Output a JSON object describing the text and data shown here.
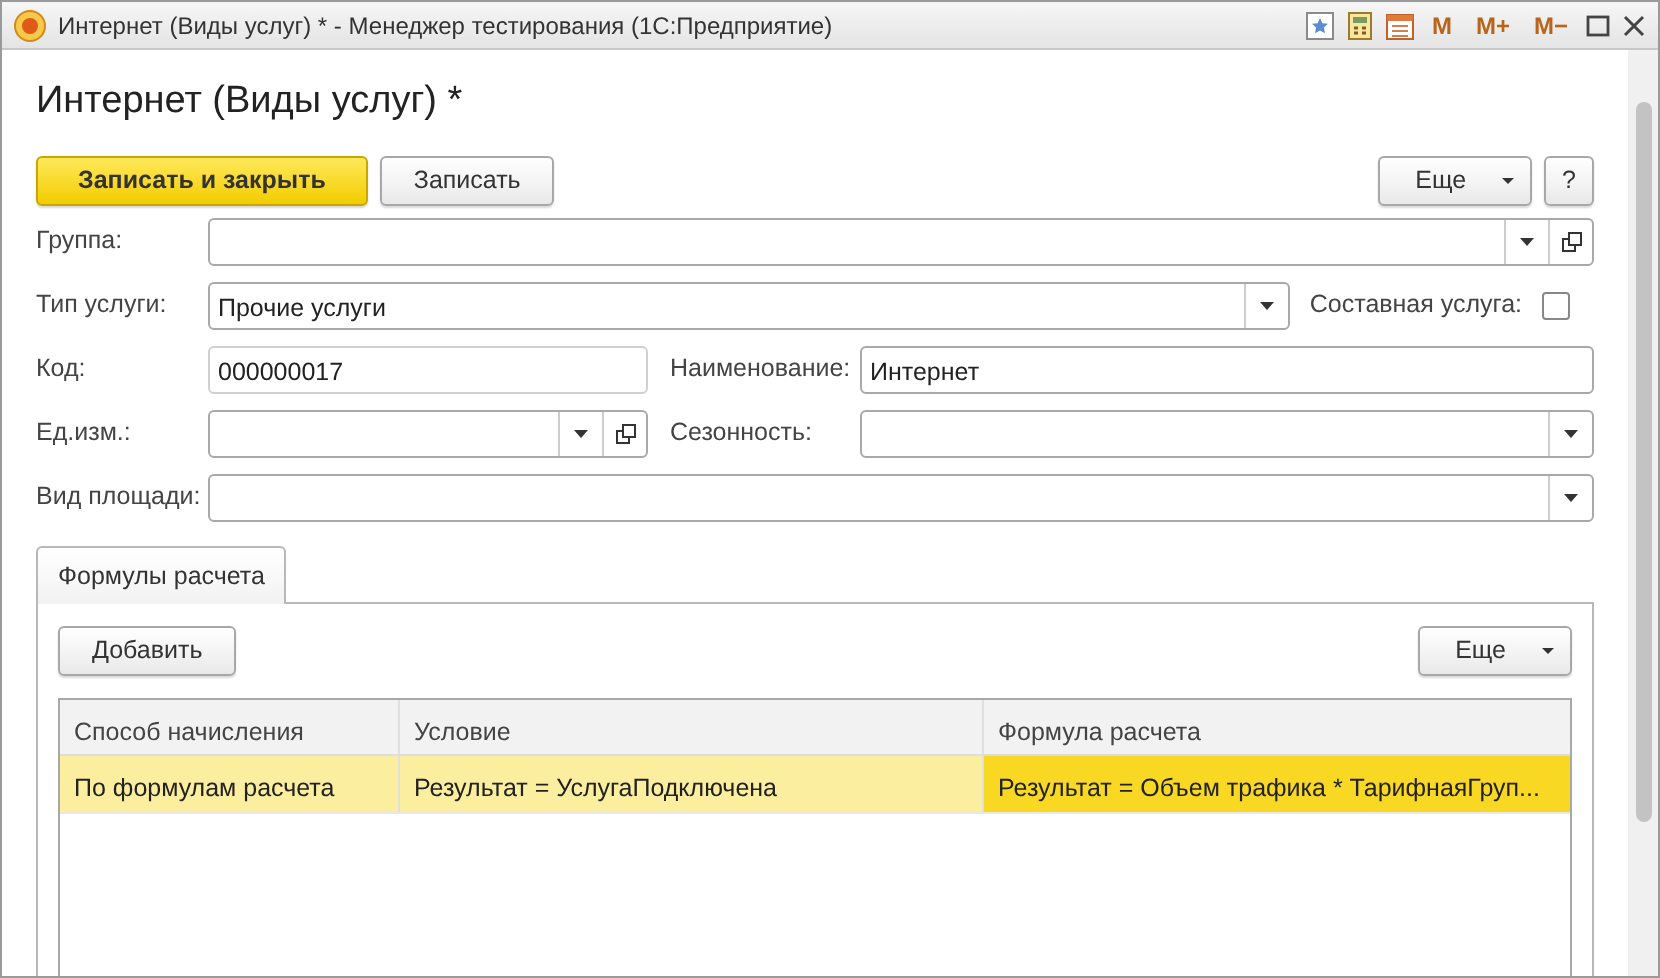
{
  "window": {
    "title": "Интернет (Виды услуг) * - Менеджер тестирования (1С:Предприятие)",
    "memory_buttons": [
      "M",
      "M+",
      "M−"
    ]
  },
  "form": {
    "title": "Интернет (Виды услуг) *",
    "toolbar": [
      {
        "label": "Записать и закрыть",
        "kind": "primary"
      },
      {
        "label": "Записать",
        "kind": "plain"
      }
    ],
    "toolbar_right": [
      {
        "label": "Еще",
        "kind": "menu"
      },
      {
        "label": "?",
        "kind": "plain"
      }
    ],
    "rows": [
      [
        {
          "kind": "select",
          "label": "Группа:",
          "open_button": true
        }
      ],
      [
        {
          "kind": "select",
          "label": "Тип услуги:",
          "value": "Прочие услуги",
          "open_button": false
        },
        {
          "kind": "checkbox",
          "label": "Составная услуга:",
          "checked": false
        }
      ],
      [
        {
          "kind": "text",
          "label": "Код:",
          "value": "000000017",
          "disabled": true
        },
        {
          "kind": "text",
          "label": "Наименование:",
          "value": "Интернет",
          "disabled": false
        }
      ],
      [
        {
          "kind": "select",
          "label": "Ед.изм.:",
          "open_button": true
        },
        {
          "kind": "select",
          "label": "Сезонность:",
          "open_button": false
        }
      ],
      [
        {
          "kind": "select",
          "label": "Вид площади:",
          "open_button": false
        }
      ]
    ]
  },
  "tabs": [
    {
      "label": "Формулы расчета",
      "selected": true
    }
  ],
  "tab_toolbar": {
    "left": [
      {
        "label": "Добавить",
        "kind": "plain"
      }
    ],
    "right": [
      {
        "label": "Еще",
        "kind": "menu"
      }
    ]
  },
  "table": {
    "columns": [
      "Способ начисления",
      "Условие",
      "Формула расчета"
    ],
    "rows": [
      {
        "selected": true,
        "cells": [
          {
            "text": "По формулам расчета",
            "current": false
          },
          {
            "text": "Результат = УслугаПодключена",
            "current": false
          },
          {
            "text": "Результат = Объем трафика * ТарифнаяГруп...",
            "current": true
          }
        ]
      }
    ]
  }
}
